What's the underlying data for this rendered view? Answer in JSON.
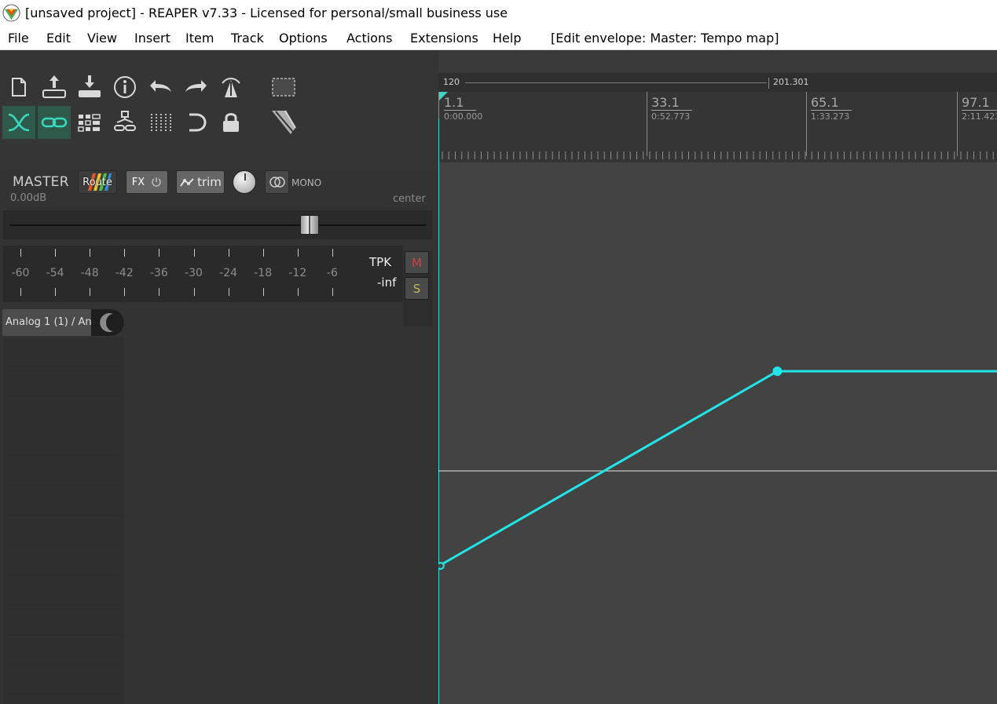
{
  "window": {
    "title": "[unsaved project] - REAPER v7.33 - Licensed for personal/small business use"
  },
  "menu": {
    "items": [
      "File",
      "Edit",
      "View",
      "Insert",
      "Item",
      "Track",
      "Options",
      "Actions",
      "Extensions",
      "Help"
    ],
    "status": "[Edit envelope: Master: Tempo map]"
  },
  "toolbar": {
    "row1": [
      "new-project-icon",
      "open-project-icon",
      "save-project-icon",
      "project-settings-icon",
      "undo-icon",
      "redo-icon",
      "metronome-icon",
      "grid-icon"
    ],
    "row2": [
      "auto-crossfade-icon",
      "locking-icon",
      "snap-icon",
      "ripple-edit-icon",
      "grid-lines-icon",
      "loop-icon",
      "lock-icon",
      "razor-edit-icon"
    ]
  },
  "master": {
    "label": "MASTER",
    "volume": "0.00dB",
    "pan": "center",
    "route_label": "Route",
    "fx_label": "FX",
    "trim_label": "trim",
    "mono_label": "MONO",
    "meter_labels": [
      "-60",
      "-54",
      "-48",
      "-42",
      "-36",
      "-30",
      "-24",
      "-18",
      "-12",
      "-6"
    ],
    "peak_label": "TPK",
    "peak_value": "-inf",
    "mute_label": "M",
    "solo_label": "S",
    "input_label": "Analog 1 (1) / An",
    "fader_level": 0.72
  },
  "timeline": {
    "tempo_start": "120",
    "tempo_end": "201.301",
    "measures": [
      {
        "measure": "1.1",
        "time": "0:00.000"
      },
      {
        "measure": "33.1",
        "time": "0:52.773"
      },
      {
        "measure": "65.1",
        "time": "1:33.273"
      },
      {
        "measure": "97.1",
        "time": "2:11.423"
      }
    ]
  },
  "envelope": {
    "name": "Master: Tempo map",
    "color": "#22e5e8",
    "points": [
      {
        "measure": "1.1",
        "bpm": 120
      },
      {
        "measure": "53.1",
        "bpm": 201.301
      }
    ]
  }
}
